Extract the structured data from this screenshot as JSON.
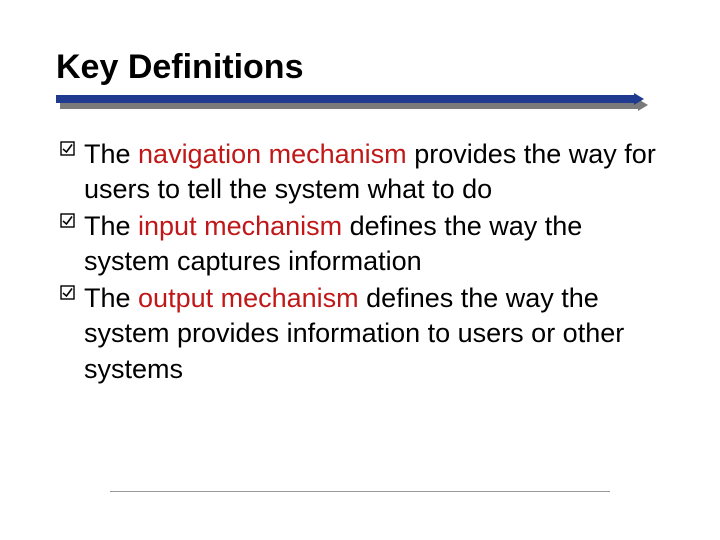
{
  "title": "Key Definitions",
  "items": [
    {
      "pre": "The ",
      "term": "navigation mechanism",
      "post": " provides the way for users to tell the system what to do"
    },
    {
      "pre": "The ",
      "term": "input mechanism",
      "post": " defines the way the system captures  information"
    },
    {
      "pre": "The ",
      "term": "output mechanism",
      "post": " defines the way the system provides information to users or other systems"
    }
  ],
  "colors": {
    "accent": "#1f3a8f",
    "term": "#c01818"
  }
}
